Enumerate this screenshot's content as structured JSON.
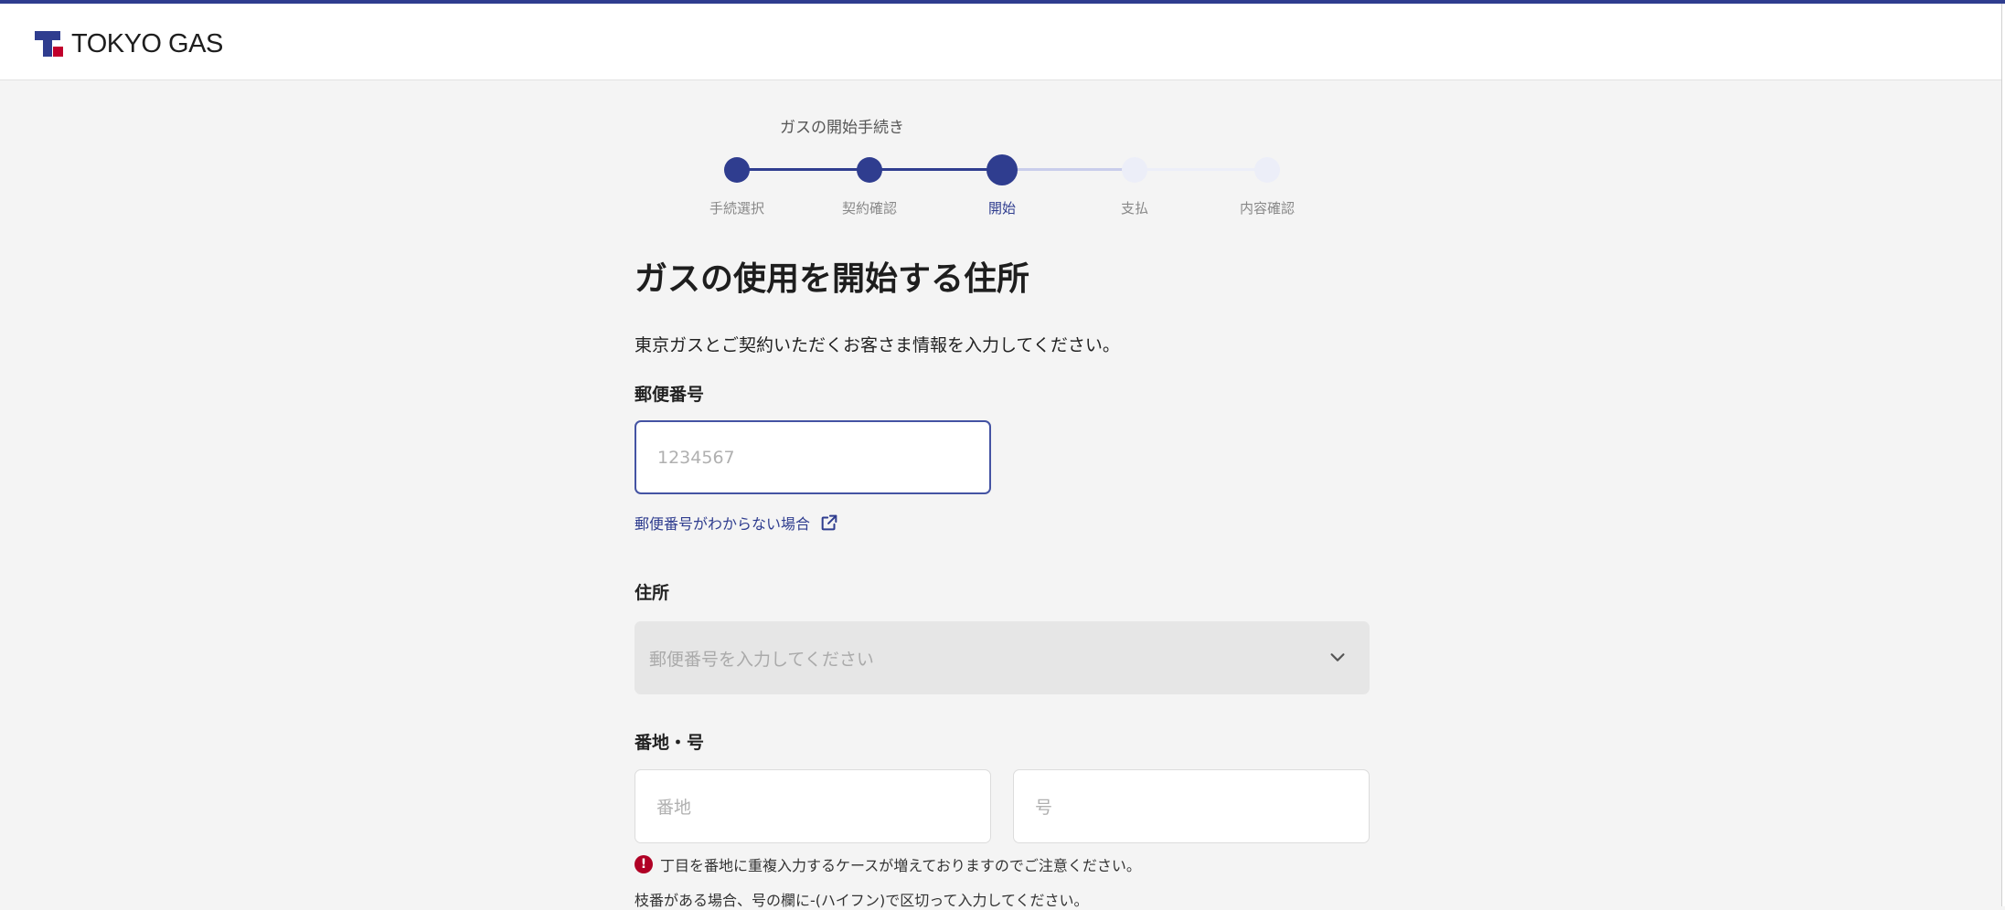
{
  "header": {
    "logo_text": "TOKYO GAS"
  },
  "stepper": {
    "title": "ガスの開始手続き",
    "steps": [
      {
        "label": "手続選択",
        "state": "done"
      },
      {
        "label": "契約確認",
        "state": "done"
      },
      {
        "label": "開始",
        "state": "current"
      },
      {
        "label": "支払",
        "state": "upcoming"
      },
      {
        "label": "内容確認",
        "state": "upcoming"
      }
    ]
  },
  "page": {
    "title": "ガスの使用を開始する住所",
    "intro": "東京ガスとご契約いただくお客さま情報を入力してください。"
  },
  "postal": {
    "label": "郵便番号",
    "placeholder": "1234567",
    "value": "",
    "help_link": "郵便番号がわからない場合"
  },
  "address": {
    "label": "住所",
    "placeholder": "郵便番号を入力してください"
  },
  "block": {
    "label": "番地・号",
    "banchi_placeholder": "番地",
    "go_placeholder": "号",
    "notice": "丁目を番地に重複入力するケースが増えておりますのでご注意ください。",
    "notice2": "枝番がある場合、号の欄に-(ハイフン)で区切って入力してください。"
  },
  "colors": {
    "brand": "#2f3d8f",
    "accent_red": "#c1002c",
    "step_upcoming": "#eceef8",
    "warning": "#b00025"
  }
}
